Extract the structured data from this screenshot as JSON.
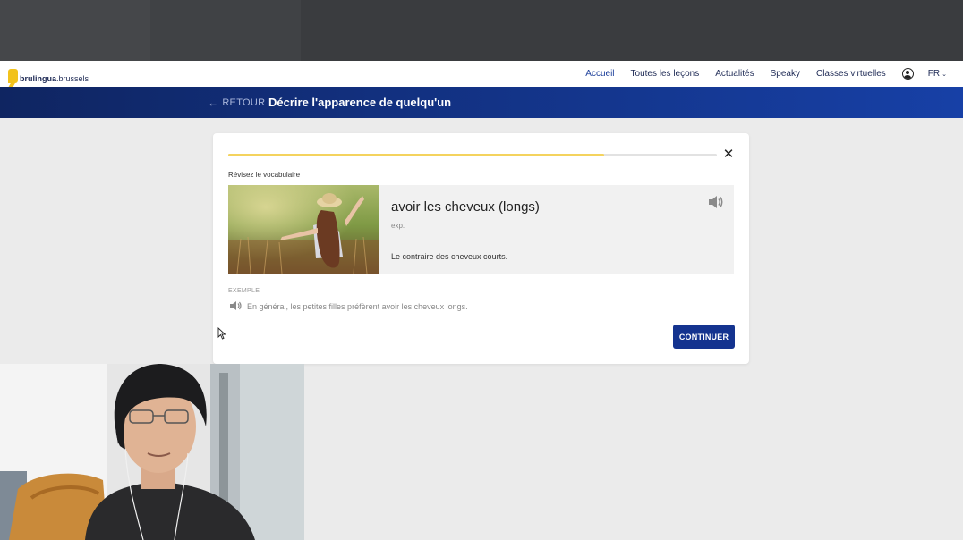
{
  "logo": {
    "name": "brulingua",
    "suffix": ".brussels"
  },
  "nav": {
    "links": [
      {
        "label": "Accueil",
        "active": true
      },
      {
        "label": "Toutes les leçons",
        "active": false
      },
      {
        "label": "Actualités",
        "active": false
      },
      {
        "label": "Speaky",
        "active": false
      },
      {
        "label": "Classes virtuelles",
        "active": false
      }
    ],
    "language": "FR",
    "chevron": "⌄"
  },
  "lesson": {
    "back_arrow": "←",
    "back_label": "RETOUR",
    "title": "Décrire l'apparence de quelqu'un"
  },
  "exercise": {
    "progress": 0.77,
    "close_glyph": "✕",
    "section_label": "Révisez le vocabulaire",
    "term": "avoir les cheveux (longs)",
    "part_of_speech": "exp.",
    "definition": "Le contraire des cheveux courts.",
    "example_label": "EXEMPLE",
    "example_sentence": "En général, les petites filles préfèrent avoir les cheveux longs.",
    "continue_label": "CONTINUER"
  },
  "colors": {
    "brand_blue": "#14338f",
    "progress_yellow": "#f4d35e",
    "logo_yellow": "#f2c21b"
  },
  "icons": [
    "user-icon",
    "close-icon",
    "speaker-icon",
    "back-arrow-icon",
    "chevron-down-icon"
  ]
}
